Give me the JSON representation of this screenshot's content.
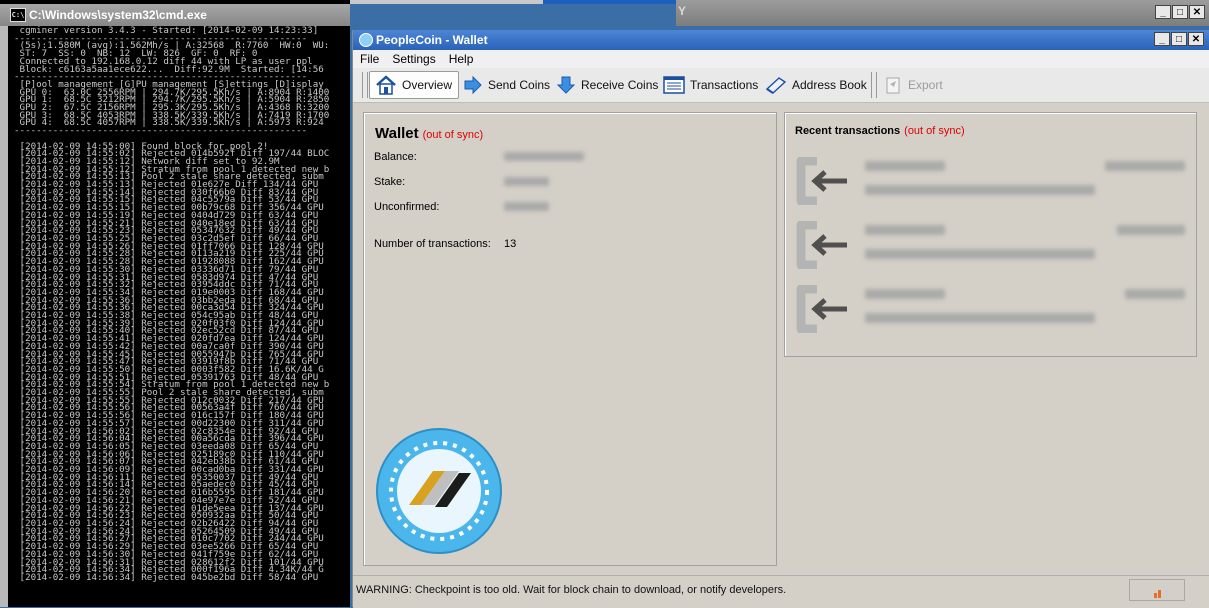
{
  "cmd": {
    "title": "C:\\Windows\\system32\\cmd.exe",
    "icon": "C:\\",
    "lines": [
      " cgminer version 3.4.3 - Started: [2014-02-09 14:23:33]",
      "-----------------------------------------------------",
      " (5s):1.580M (avg):1.562Mh/s | A:32568  R:7760  HW:0  WU:",
      " ST: 7  SS: 0  NB: 12  LW: 826  GF: 0  RF: 0",
      " Connected to 192.168.0.12 diff 44 with LP as user ppl",
      " Block: c6163a5aa1ece622...  Diff:92.9M  Started: [14:56",
      "-----------------------------------------------------",
      " [P]ool management [G]PU management [S]ettings [D]isplay",
      " GPU 0:  63.0C 2556RPM | 294.7K/295.5Kh/s | A:8904 R:1400",
      " GPU 1:  68.5C 3212RPM | 294.7K/295.5Kh/s | A:5904 R:2850",
      " GPU 2:  67.5C 2156RPM | 295.3K/295.5Kh/s | A:4368 R:3200",
      " GPU 3:  68.5C 4053RPM | 338.5K/339.5Kh/s | A:7419 R:1700",
      " GPU 4:  68.5C 4057RPM | 338.5K/339.5Kh/s | A:5973 R:924",
      "-----------------------------------------------------",
      "",
      " [2014-02-09 14:55:00] Found block for pool 2!",
      " [2014-02-09 14:55:02] Rejected 014b592f Diff 197/44 BLOC",
      " [2014-02-09 14:55:12] Network diff set to 92.9M",
      " [2014-02-09 14:55:12] Stratum from pool 1 detected new b",
      " [2014-02-09 14:55:13] Pool 2 stale share detected, subm",
      " [2014-02-09 14:55:13] Rejected 01e627e Diff 134/44 GPU",
      " [2014-02-09 14:55:14] Rejected 030f66b0 Diff 83/44 GPU",
      " [2014-02-09 14:55:15] Rejected 04c5579a Diff 53/44 GPU",
      " [2014-02-09 14:55:15] Rejected 00b79c68 Diff 356/44 GPU",
      " [2014-02-09 14:55:19] Rejected 0404d729 Diff 63/44 GPU",
      " [2014-02-09 14:55:21] Rejected 040e18ed Diff 63/44 GPU",
      " [2014-02-09 14:55:23] Rejected 05347632 Diff 49/44 GPU",
      " [2014-02-09 14:55:25] Rejected 03c2d5ef Diff 66/44 GPU",
      " [2014-02-09 14:55:26] Rejected 01ff7066 Diff 128/44 GPU",
      " [2014-02-09 14:55:28] Rejected 0113a219 Diff 225/44 GPU",
      " [2014-02-09 14:55:28] Rejected 01928088 Diff 162/44 GPU",
      " [2014-02-09 14:55:30] Rejected 03336d71 Diff 79/44 GPU",
      " [2014-02-09 14:55:31] Rejected 0583d974 Diff 47/44 GPU",
      " [2014-02-09 14:55:32] Rejected 03954ddc Diff 71/44 GPU",
      " [2014-02-09 14:55:34] Rejected 019e0003 Diff 168/44 GPU",
      " [2014-02-09 14:55:36] Rejected 03bb2eda Diff 68/44 GPU",
      " [2014-02-09 14:55:36] Rejected 00ca3d54 Diff 324/44 GPU",
      " [2014-02-09 14:55:38] Rejected 054c95ab Diff 48/44 GPU",
      " [2014-02-09 14:55:39] Rejected 020f03f0 Diff 124/44 GPU",
      " [2014-02-09 14:55:40] Rejected 02ec52cd Diff 87/44 GPU",
      " [2014-02-09 14:55:41] Rejected 020fd7ea Diff 124/44 GPU",
      " [2014-02-09 14:55:42] Rejected 00a7ca0f Diff 390/44 GPU",
      " [2014-02-09 14:55:45] Rejected 0055947b Diff 765/44 GPU",
      " [2014-02-09 14:55:47] Rejected 03919f8b Diff 71/44 GPU",
      " [2014-02-09 14:55:50] Rejected 0003f582 Diff 16.6K/44 G",
      " [2014-02-09 14:55:51] Rejected 05391763 Diff 48/44 GPU",
      " [2014-02-09 14:55:54] Stratum from pool 1 detected new b",
      " [2014-02-09 14:55:55] Pool 2 stale share detected, subm",
      " [2014-02-09 14:55:55] Rejected 012c0032 Diff 217/44 GPU",
      " [2014-02-09 14:55:56] Rejected 00563a4f Diff 760/44 GPU",
      " [2014-02-09 14:55:56] Rejected 016c157f Diff 180/44 GPU",
      " [2014-02-09 14:55:57] Rejected 00d22300 Diff 311/44 GPU",
      " [2014-02-09 14:56:02] Rejected 02c8354e Diff 92/44 GPU",
      " [2014-02-09 14:56:04] Rejected 00a56cda Diff 396/44 GPU",
      " [2014-02-09 14:56:05] Rejected 03eeda08 Diff 65/44 GPU",
      " [2014-02-09 14:56:06] Rejected 025189c0 Diff 110/44 GPU",
      " [2014-02-09 14:56:07] Rejected 042eb38b Diff 61/44 GPU",
      " [2014-02-09 14:56:09] Rejected 00cad0ba Diff 331/44 GPU",
      " [2014-02-09 14:56:11] Rejected 05350037 Diff 49/44 GPU",
      " [2014-02-09 14:56:14] Rejected 05aedec0 Diff 45/44 GPU",
      " [2014-02-09 14:56:20] Rejected 016b5595 Diff 181/44 GPU",
      " [2014-02-09 14:56:21] Rejected 04e97e7e Diff 52/44 GPU",
      " [2014-02-09 14:56:22] Rejected 01de5eea Diff 137/44 GPU",
      " [2014-02-09 14:56:23] Rejected 050932aa Diff 50/44 GPU",
      " [2014-02-09 14:56:24] Rejected 02b26422 Diff 94/44 GPU",
      " [2014-02-09 14:56:24] Rejected 05264509 Diff 49/44 GPU",
      " [2014-02-09 14:56:27] Rejected 010c7702 Diff 244/44 GPU",
      " [2014-02-09 14:56:29] Rejected 03ee5266 Diff 65/44 GPU",
      " [2014-02-09 14:56:30] Rejected 041f759e Diff 62/44 GPU",
      " [2014-02-09 14:56:31] Rejected 028612f2 Diff 101/44 GPU",
      " [2014-02-09 14:56:34] Rejected 000f196a Diff 4.34K/44 G",
      " [2014-02-09 14:56:34] Rejected 045be2bd Diff 58/44 GPU"
    ]
  },
  "background_window": {
    "title": "Y"
  },
  "wallet": {
    "title": "PeopleCoin - Wallet",
    "menu": [
      "File",
      "Settings",
      "Help"
    ],
    "toolbar": {
      "overview": "Overview",
      "send": "Send Coins",
      "receive": "Receive Coins",
      "transactions": "Transactions",
      "address_book": "Address Book",
      "export": "Export"
    },
    "overview": {
      "heading": "Wallet",
      "out_of_sync": "(out of sync)",
      "balance_label": "Balance:",
      "stake_label": "Stake:",
      "unconfirmed_label": "Unconfirmed:",
      "num_tx_label": "Number of transactions:",
      "num_tx_value": "13"
    },
    "recent": {
      "heading": "Recent transactions",
      "out_of_sync": "(out of sync)"
    },
    "status_warning": "WARNING: Checkpoint is too old. Wait for block chain to download, or notify developers."
  },
  "colors": {
    "wallet_titlebar": "#2a62b8",
    "out_of_sync": "#e00000",
    "console_text": "#c8c8c8",
    "coin_blue": "#4ab6ec"
  },
  "icons": [
    "home-icon",
    "send-arrow-icon",
    "receive-arrow-icon",
    "transactions-list-icon",
    "address-book-icon",
    "export-icon",
    "incoming-tx-icon",
    "peoplecoin-logo-icon",
    "signal-bars-icon"
  ]
}
